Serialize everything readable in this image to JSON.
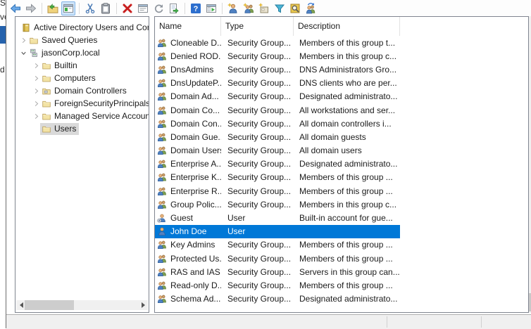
{
  "background": {
    "fragments": [
      "Ser",
      "ver",
      "d S"
    ]
  },
  "toolbar": {
    "buttons": [
      {
        "name": "back",
        "icon": "back-arrow"
      },
      {
        "name": "forward",
        "icon": "forward-arrow"
      },
      {
        "sep": true
      },
      {
        "name": "open-new-window",
        "icon": "folder-new-window"
      },
      {
        "name": "show-console-panes",
        "icon": "window-panes",
        "active": true
      },
      {
        "sep": true
      },
      {
        "name": "cut",
        "icon": "scissors"
      },
      {
        "name": "paste",
        "icon": "clipboard"
      },
      {
        "sep": true
      },
      {
        "name": "delete",
        "icon": "red-x"
      },
      {
        "name": "properties",
        "icon": "properties-window"
      },
      {
        "name": "refresh",
        "icon": "refresh-arrow"
      },
      {
        "name": "export-list",
        "icon": "export-document"
      },
      {
        "sep": true
      },
      {
        "name": "help",
        "icon": "question-mark"
      },
      {
        "name": "show-hide-console-tree",
        "icon": "console-tree-window"
      },
      {
        "sep": true
      },
      {
        "name": "new-user",
        "icon": "person-new"
      },
      {
        "name": "new-group",
        "icon": "people-new"
      },
      {
        "name": "new-organizational-unit",
        "icon": "box-new"
      },
      {
        "name": "set-filter",
        "icon": "funnel"
      },
      {
        "name": "find-objects",
        "icon": "magnifier-document"
      },
      {
        "name": "people-sync",
        "icon": "people-refresh"
      }
    ]
  },
  "tree": {
    "items": [
      {
        "label": "Active Directory Users and Computers",
        "depth": 0,
        "expander": "none",
        "icon": "directory-book"
      },
      {
        "label": "Saved Queries",
        "depth": 1,
        "expander": "collapsed",
        "icon": "folder"
      },
      {
        "label": "jasonCorp.local",
        "depth": 1,
        "expander": "expanded",
        "icon": "domain"
      },
      {
        "label": "Builtin",
        "depth": 2,
        "expander": "collapsed",
        "icon": "folder"
      },
      {
        "label": "Computers",
        "depth": 2,
        "expander": "collapsed",
        "icon": "folder"
      },
      {
        "label": "Domain Controllers",
        "depth": 2,
        "expander": "collapsed",
        "icon": "folder-dc"
      },
      {
        "label": "ForeignSecurityPrincipals",
        "depth": 2,
        "expander": "collapsed",
        "icon": "folder"
      },
      {
        "label": "Managed Service Accounts",
        "depth": 2,
        "expander": "collapsed",
        "icon": "folder"
      },
      {
        "label": "Users",
        "depth": 2,
        "expander": "none",
        "icon": "folder",
        "selected": true
      }
    ]
  },
  "list": {
    "columns": [
      {
        "label": "Name"
      },
      {
        "label": "Type"
      },
      {
        "label": "Description"
      }
    ],
    "rows": [
      {
        "name": "Cloneable D...",
        "type": "Security Group...",
        "description": "Members of this group t...",
        "icon": "group"
      },
      {
        "name": "Denied ROD...",
        "type": "Security Group...",
        "description": "Members in this group c...",
        "icon": "group"
      },
      {
        "name": "DnsAdmins",
        "type": "Security Group...",
        "description": "DNS Administrators Gro...",
        "icon": "group"
      },
      {
        "name": "DnsUpdateP...",
        "type": "Security Group...",
        "description": "DNS clients who are per...",
        "icon": "group"
      },
      {
        "name": "Domain Ad...",
        "type": "Security Group...",
        "description": "Designated administrato...",
        "icon": "group"
      },
      {
        "name": "Domain Co...",
        "type": "Security Group...",
        "description": "All workstations and ser...",
        "icon": "group"
      },
      {
        "name": "Domain Con...",
        "type": "Security Group...",
        "description": "All domain controllers i...",
        "icon": "group"
      },
      {
        "name": "Domain Gue...",
        "type": "Security Group...",
        "description": "All domain guests",
        "icon": "group"
      },
      {
        "name": "Domain Users",
        "type": "Security Group...",
        "description": "All domain users",
        "icon": "group"
      },
      {
        "name": "Enterprise A...",
        "type": "Security Group...",
        "description": "Designated administrato...",
        "icon": "group"
      },
      {
        "name": "Enterprise K...",
        "type": "Security Group...",
        "description": "Members of this group ...",
        "icon": "group"
      },
      {
        "name": "Enterprise R...",
        "type": "Security Group...",
        "description": "Members of this group ...",
        "icon": "group"
      },
      {
        "name": "Group Polic...",
        "type": "Security Group...",
        "description": "Members in this group c...",
        "icon": "group"
      },
      {
        "name": "Guest",
        "type": "User",
        "description": "Built-in account for gue...",
        "icon": "user-disabled"
      },
      {
        "name": "John Doe",
        "type": "User",
        "description": "",
        "icon": "user",
        "selected": true
      },
      {
        "name": "Key Admins",
        "type": "Security Group...",
        "description": "Members of this group ...",
        "icon": "group"
      },
      {
        "name": "Protected Us...",
        "type": "Security Group...",
        "description": "Members of this group ...",
        "icon": "group"
      },
      {
        "name": "RAS and IAS ...",
        "type": "Security Group...",
        "description": "Servers in this group can...",
        "icon": "group"
      },
      {
        "name": "Read-only D...",
        "type": "Security Group...",
        "description": "Members of this group ...",
        "icon": "group"
      },
      {
        "name": "Schema Ad...",
        "type": "Security Group...",
        "description": "Designated administrato...",
        "icon": "group"
      }
    ]
  },
  "colors": {
    "selection_blue": "#0078d7",
    "tree_selection_gray": "#d9d9d9",
    "background_selection_blue": "#2663ad",
    "status_bar_gray": "#f0f0f0"
  }
}
